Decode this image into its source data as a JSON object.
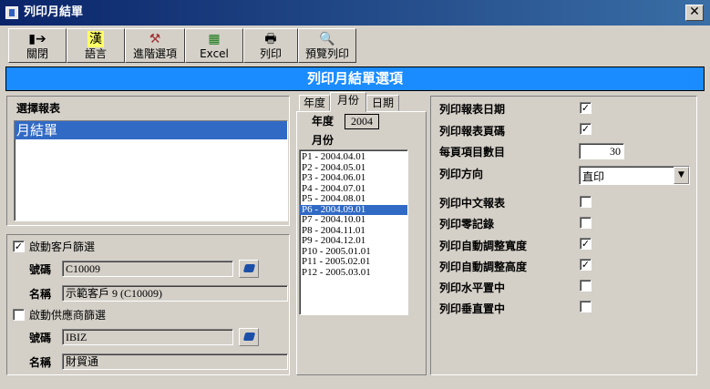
{
  "window": {
    "title": "列印月結單"
  },
  "toolbar": {
    "close": "關閉",
    "language": "語言",
    "advanced": "進階選項",
    "excel": "Excel",
    "print": "列印",
    "preview": "預覽列印"
  },
  "banner": "列印月結單選項",
  "report": {
    "label": "選擇報表",
    "items": [
      "月結單"
    ]
  },
  "customer_filter": {
    "label": "啟動客戶篩選",
    "checked": true,
    "code_label": "號碼",
    "code": "C10009",
    "name_label": "名稱",
    "name": "示範客戶 9 (C10009)"
  },
  "supplier_filter": {
    "label": "啟動供應商篩選",
    "checked": false,
    "code_label": "號碼",
    "code": "IBIZ",
    "name_label": "名稱",
    "name": "財貿通"
  },
  "tabs": [
    "年度",
    "月份",
    "日期"
  ],
  "year_label": "年度",
  "year": "2004",
  "month_label": "月份",
  "periods": [
    "P1 - 2004.04.01",
    "P2 - 2004.05.01",
    "P3 - 2004.06.01",
    "P4 - 2004.07.01",
    "P5 - 2004.08.01",
    "P6 - 2004.09.01",
    "P7 - 2004.10.01",
    "P8 - 2004.11.01",
    "P9 - 2004.12.01",
    "P10 - 2005.01.01",
    "P11 - 2005.02.01",
    "P12 - 2005.03.01"
  ],
  "selected_period": "P6 - 2004.09.01",
  "options": {
    "print_date": {
      "label": "列印報表日期",
      "checked": true
    },
    "print_page": {
      "label": "列印報表頁碼",
      "checked": true
    },
    "items_per_page": {
      "label": "每頁項目數目",
      "value": "30"
    },
    "orientation": {
      "label": "列印方向",
      "value": "直印"
    },
    "chinese_report": {
      "label": "列印中文報表",
      "checked": false
    },
    "zero_records": {
      "label": "列印零記錄",
      "checked": false
    },
    "auto_width": {
      "label": "列印自動調整寬度",
      "checked": true
    },
    "auto_height": {
      "label": "列印自動調整高度",
      "checked": true
    },
    "h_center": {
      "label": "列印水平置中",
      "checked": false
    },
    "v_center": {
      "label": "列印垂直置中",
      "checked": false
    }
  }
}
